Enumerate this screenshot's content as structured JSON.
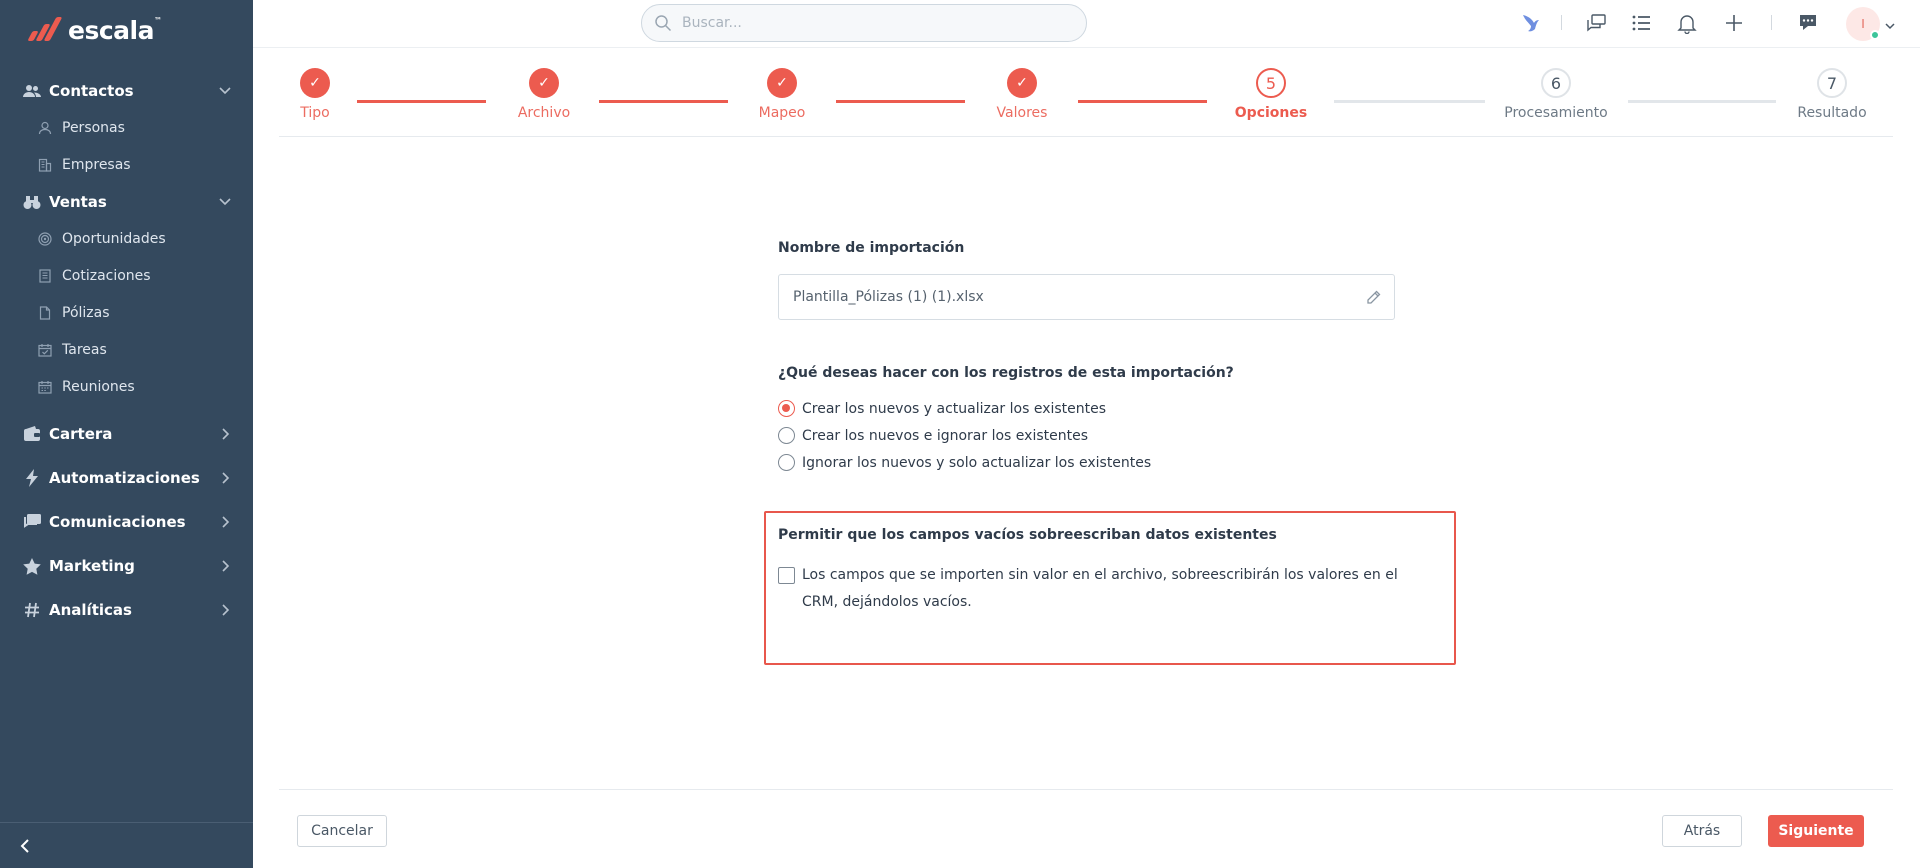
{
  "brand": {
    "name": "escala",
    "mark": "™"
  },
  "colors": {
    "sidebar": "#34495e",
    "accent": "#ec5b4f",
    "highlight": "#e8574c"
  },
  "sidebar": {
    "groups": [
      {
        "label": "Contactos",
        "icon": "people-icon",
        "expanded": true,
        "items": [
          {
            "label": "Personas",
            "icon": "person-icon"
          },
          {
            "label": "Empresas",
            "icon": "building-icon"
          }
        ]
      },
      {
        "label": "Ventas",
        "icon": "binoculars-icon",
        "expanded": true,
        "items": [
          {
            "label": "Oportunidades",
            "icon": "target-icon"
          },
          {
            "label": "Cotizaciones",
            "icon": "document-icon"
          },
          {
            "label": "Pólizas",
            "icon": "file-icon"
          },
          {
            "label": "Tareas",
            "icon": "calendar-check-icon"
          },
          {
            "label": "Reuniones",
            "icon": "calendar-icon"
          }
        ]
      },
      {
        "label": "Cartera",
        "icon": "wallet-icon",
        "expanded": false
      },
      {
        "label": "Automatizaciones",
        "icon": "bolt-icon",
        "expanded": false
      },
      {
        "label": "Comunicaciones",
        "icon": "chat-icon",
        "expanded": false
      },
      {
        "label": "Marketing",
        "icon": "star-icon",
        "expanded": false
      },
      {
        "label": "Analíticas",
        "icon": "hash-icon",
        "expanded": false
      }
    ]
  },
  "topbar": {
    "search_placeholder": "Buscar...",
    "icons": [
      "bird-icon",
      "chat-bubbles-icon",
      "list-icon",
      "bell-icon",
      "plus-icon",
      "support-chat-icon"
    ],
    "avatar_initial": "I"
  },
  "stepper": {
    "steps": [
      {
        "label": "Tipo",
        "status": "done",
        "marker": "✓"
      },
      {
        "label": "Archivo",
        "status": "done",
        "marker": "✓"
      },
      {
        "label": "Mapeo",
        "status": "done",
        "marker": "✓"
      },
      {
        "label": "Valores",
        "status": "done",
        "marker": "✓"
      },
      {
        "label": "Opciones",
        "status": "current",
        "marker": "5"
      },
      {
        "label": "Procesamiento",
        "status": "todo",
        "marker": "6"
      },
      {
        "label": "Resultado",
        "status": "todo",
        "marker": "7"
      }
    ]
  },
  "form": {
    "name_label": "Nombre de importación",
    "name_value": "Plantilla_Pólizas (1) (1).xlsx",
    "records_question": "¿Qué deseas hacer con los registros de esta importación?",
    "options": [
      {
        "label": "Crear los nuevos y actualizar los existentes",
        "checked": true
      },
      {
        "label": "Crear los nuevos e ignorar los existentes",
        "checked": false
      },
      {
        "label": "Ignorar los nuevos y solo actualizar los existentes",
        "checked": false
      }
    ],
    "empty_fields_title": "Permitir que los campos vacíos sobreescriban datos existentes",
    "empty_fields_checkbox": "Los campos que se importen sin valor en el archivo, sobreescribirán los valores en el CRM, dejándolos vacíos.",
    "empty_fields_checked": false
  },
  "footer": {
    "cancel_label": "Cancelar",
    "back_label": "Atrás",
    "next_label": "Siguiente"
  }
}
